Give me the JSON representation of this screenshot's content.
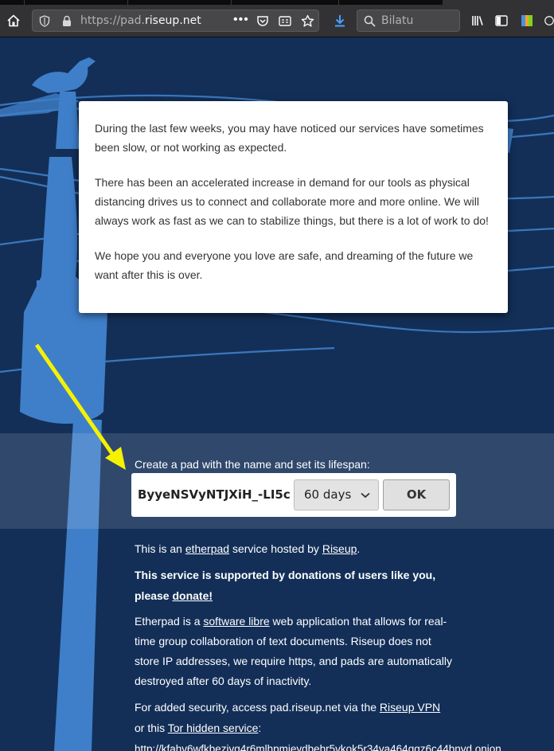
{
  "browser": {
    "url_prefix": "https://pad.",
    "url_domain": "riseup.net",
    "search_placeholder": "Bilatu"
  },
  "notice": {
    "p1": "During the last few weeks, you may have noticed our services have sometimes been slow, or not working as expected.",
    "p2": "There has been an accelerated increase in demand for our tools as physical distancing drives us to connect and collaborate more and more online. We will always work as fast as we can to stabilize things, but there is a lot of work to do!",
    "p3": "We hope you and everyone you love are safe, and dreaming of the future we want after this is over."
  },
  "create": {
    "label": "Create a pad with the name and set its lifespan:",
    "pad_name": "ByyeNSVyNTJXiH_-LI5c",
    "lifespan": "60 days",
    "ok": "OK"
  },
  "info": {
    "l1a": "This is an ",
    "l1_link1": "etherpad",
    "l1b": " service hosted by ",
    "l1_link2": "Riseup",
    "l1c": ".",
    "l2a": "This service is supported by donations of users like you, please ",
    "l2_link": "donate!",
    "l3a": "Etherpad is a ",
    "l3_link": "software libre",
    "l3b": " web application that allows for real-time group collaboration of text documents. Riseup does not store IP addresses, we require https, and pads are automatically destroyed after 60 days of inactivity.",
    "l4a": "For added security, access pad.riseup.net via the ",
    "l4_link1": "Riseup VPN",
    "l4b": " or this ",
    "l4_link2": "Tor hidden service",
    "l4c": ":",
    "onion": "http://kfahv6wfkbezivg4r6mlhpmieydbebr5vkok5r34ya464ggz6c44bnyd.onion."
  },
  "colors": {
    "page_bg": "#132f58",
    "illustration": "#3f7fc9",
    "arrow": "#f5f200"
  }
}
